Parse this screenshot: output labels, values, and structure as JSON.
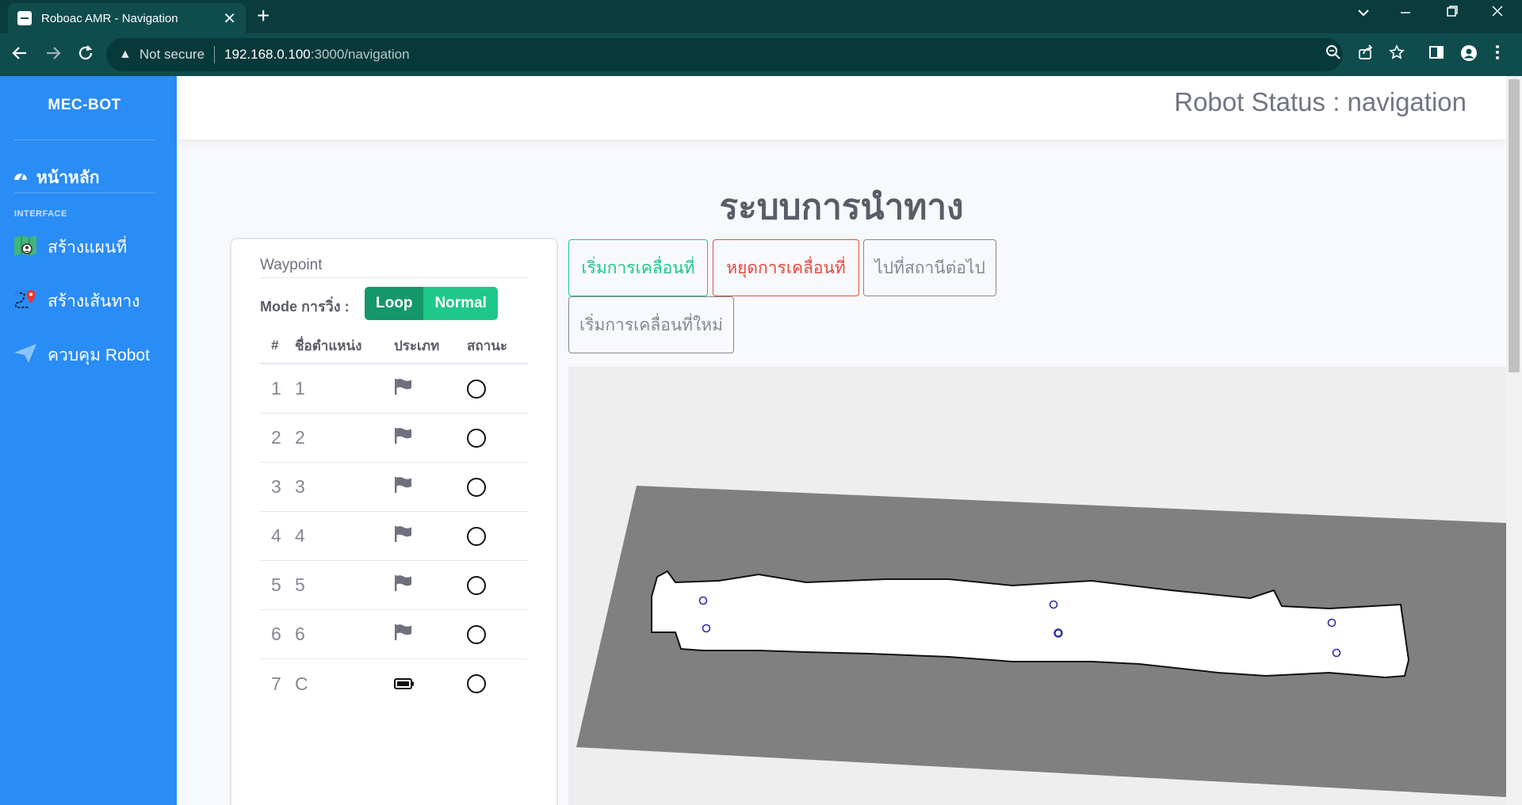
{
  "browser": {
    "tab_title": "Roboac AMR - Navigation",
    "tab_close": "✕",
    "new_tab": "+",
    "address": {
      "security_label": "Not secure",
      "host": "192.168.0.100",
      "path": ":3000/navigation"
    },
    "icons": [
      "back-icon",
      "forward-icon",
      "reload-icon",
      "warning-icon",
      "zoom-icon",
      "share-icon",
      "star-icon",
      "sidepanel-icon",
      "profile-icon",
      "menu-icon"
    ]
  },
  "sidebar": {
    "brand": "MEC-BOT",
    "home": {
      "label": "หน้าหลัก",
      "icon": "dashboard-icon"
    },
    "section_heading": "INTERFACE",
    "items": [
      {
        "label": "สร้างแผนที่",
        "icon": "map-icon"
      },
      {
        "label": "สร้างเส้นทาง",
        "icon": "route-icon"
      },
      {
        "label": "ควบคุม Robot",
        "icon": "paper-plane-icon"
      }
    ]
  },
  "topbar": {
    "robot_status": "Robot Status : navigation"
  },
  "main": {
    "title": "ระบบการนำทาง",
    "buttons": {
      "start": "เริ่มการเคลื่อนที่",
      "stop": "หยุดการเคลื่อนที่",
      "next": "ไปที่สถานีต่อไป",
      "restart": "เริ่มการเคลื่อนที่ใหม่"
    }
  },
  "waypoint": {
    "title": "Waypoint",
    "mode_label": "Mode การวิ่ง :",
    "modes": {
      "loop": "Loop",
      "normal": "Normal"
    },
    "columns": {
      "num": "#",
      "name": "ชื่อตำแหน่ง",
      "type": "ประเภท",
      "status": "สถานะ"
    },
    "rows": [
      {
        "num": "1",
        "name": "1",
        "type": "flag-icon"
      },
      {
        "num": "2",
        "name": "2",
        "type": "flag-icon"
      },
      {
        "num": "3",
        "name": "3",
        "type": "flag-icon"
      },
      {
        "num": "4",
        "name": "4",
        "type": "flag-icon"
      },
      {
        "num": "5",
        "name": "5",
        "type": "flag-icon"
      },
      {
        "num": "6",
        "name": "6",
        "type": "flag-icon"
      },
      {
        "num": "7",
        "name": "C",
        "type": "battery-icon"
      }
    ]
  },
  "colors": {
    "sidebar": "#2a8cf5",
    "success": "#1cc88a",
    "danger": "#e74a3b",
    "secondary": "#858796",
    "loop_active": "#14976b",
    "browser_frame": "#0f4c4e"
  }
}
